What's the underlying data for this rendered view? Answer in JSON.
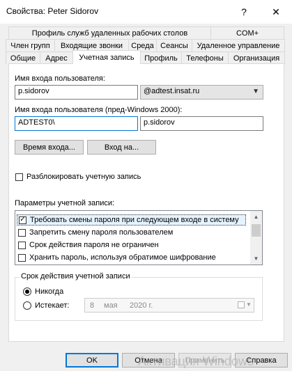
{
  "window": {
    "title": "Свойства: Peter Sidorov",
    "help_glyph": "?",
    "close_glyph": "✕"
  },
  "tabs": {
    "row1": [
      "Профиль служб удаленных рабочих столов",
      "COM+"
    ],
    "row2": [
      "Член групп",
      "Входящие звонки",
      "Среда",
      "Сеансы",
      "Удаленное управление"
    ],
    "row3": [
      "Общие",
      "Адрес",
      "Учетная запись",
      "Профиль",
      "Телефоны",
      "Организация"
    ],
    "selected": "Учетная запись"
  },
  "account": {
    "logon_name_label": "Имя входа пользователя:",
    "logon_name_value": "p.sidorov",
    "domain_value": "@adtest.insat.ru",
    "pre2000_label": "Имя входа пользователя (пред-Windows 2000):",
    "pre2000_domain": "ADTEST0\\",
    "pre2000_name": "p.sidorov",
    "logon_hours_button": "Время входа...",
    "logon_to_button": "Вход на...",
    "unlock_label": "Разблокировать учетную запись"
  },
  "options": {
    "label": "Параметры учетной записи:",
    "items": [
      {
        "text": "Требовать смены пароля при следующем входе в систему",
        "checked": "✓"
      },
      {
        "text": "Запретить смену пароля пользователем",
        "checked": ""
      },
      {
        "text": "Срок действия пароля не ограничен",
        "checked": ""
      },
      {
        "text": "Хранить пароль, используя обратимое шифрование",
        "checked": ""
      }
    ]
  },
  "expiry": {
    "group_title": "Срок действия учетной записи",
    "never_label": "Никогда",
    "end_label": "Истекает:",
    "date_day": "8",
    "date_month": "мая",
    "date_year": "2020 г.",
    "selected": "Никогда"
  },
  "footer": {
    "ok": "OK",
    "cancel": "Отмена",
    "apply": "Применить",
    "help": "Справка"
  },
  "watermark": "Активация Windows",
  "colors": {
    "focus": "#0078d7",
    "dialog_bg": "#f0f0f0"
  }
}
